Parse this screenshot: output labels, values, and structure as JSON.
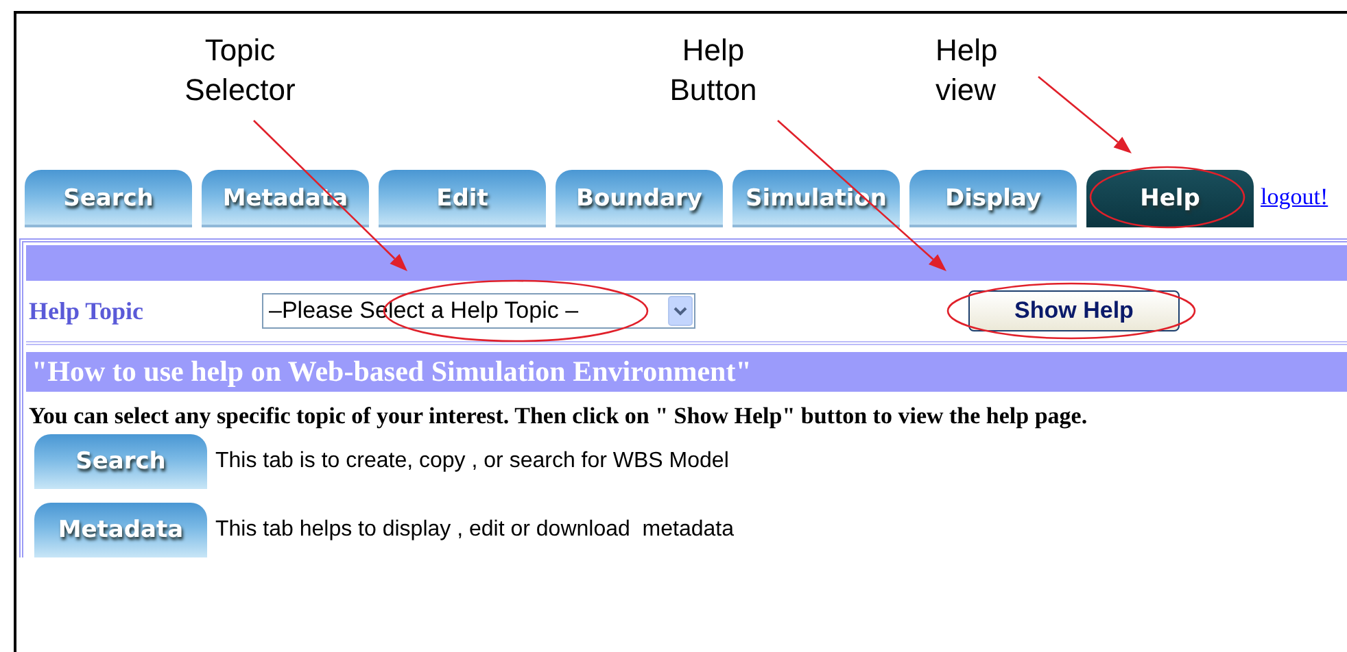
{
  "callouts": [
    {
      "lines": [
        "Topic",
        "Selector"
      ]
    },
    {
      "lines": [
        "Help",
        "Button"
      ]
    },
    {
      "lines": [
        "Help",
        "view"
      ]
    }
  ],
  "tabs": [
    {
      "label": "Search",
      "selected": false
    },
    {
      "label": "Metadata",
      "selected": false
    },
    {
      "label": "Edit",
      "selected": false
    },
    {
      "label": "Boundary",
      "selected": false
    },
    {
      "label": "Simulation",
      "selected": false
    },
    {
      "label": "Display",
      "selected": false
    },
    {
      "label": "Help",
      "selected": true
    }
  ],
  "logout_link": "logout!",
  "help_topic": {
    "label": "Help Topic",
    "value": "–Please Select a Help Topic –",
    "button": "Show Help"
  },
  "heading": "\"How to use help on Web-based Simulation Environment\"",
  "intro": "You can select any specific topic of your interest. Then click on \" Show Help\" button to view the help page.",
  "tab_help": [
    {
      "tab": "Search",
      "description": "This tab is to create, copy , or search for WBS Model"
    },
    {
      "tab": "Metadata",
      "description": "This tab helps to display , edit or download  metadata"
    }
  ]
}
